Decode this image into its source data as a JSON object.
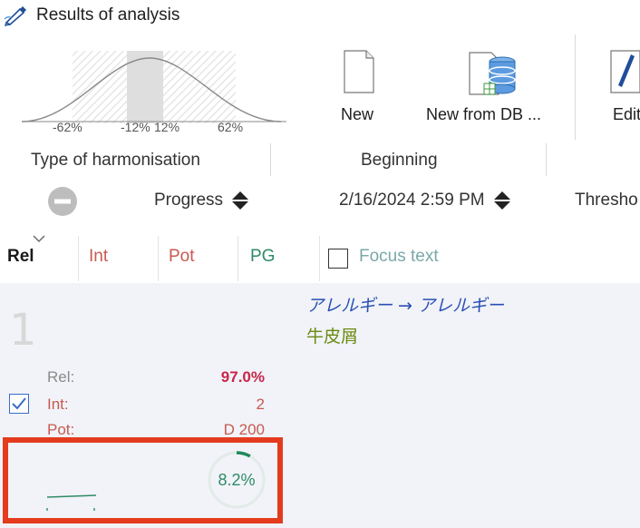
{
  "window": {
    "title": "Results of analysis",
    "icon": "analysis-pen-icon"
  },
  "ribbon": {
    "distribution": {
      "labels": [
        "-62%",
        "-12%",
        "12%",
        "62%"
      ]
    },
    "new_label": "New",
    "new_from_db_label": "New from DB ...",
    "edit_label": "Edit"
  },
  "filters": {
    "type_of_harmonisation": "Type of harmonisation",
    "beginning": "Beginning",
    "progress": "Progress",
    "date": "2/16/2024 2:59 PM",
    "threshold": "Thresho"
  },
  "columns": {
    "rel": "Rel",
    "int": "Int",
    "pot": "Pot",
    "pg": "PG",
    "focus_text": "Focus text"
  },
  "result": {
    "rank": "1",
    "line1": "アレルギー → アレルギー",
    "line2": "牛皮屑",
    "metrics": [
      {
        "label": "Rel:",
        "value": "97.0%"
      },
      {
        "label": "Int:",
        "value": "2"
      },
      {
        "label": "Pot:",
        "value": "D 200"
      }
    ],
    "selected": true,
    "pg_percent": "8.2%",
    "pg_fraction": 0.082
  },
  "colors": {
    "rel": "#c8264a",
    "int": "#c85a50",
    "pot": "#c85a50",
    "pg": "#2f8a66",
    "focus": "#7aa8a8",
    "highlight": "#e43b1e"
  }
}
